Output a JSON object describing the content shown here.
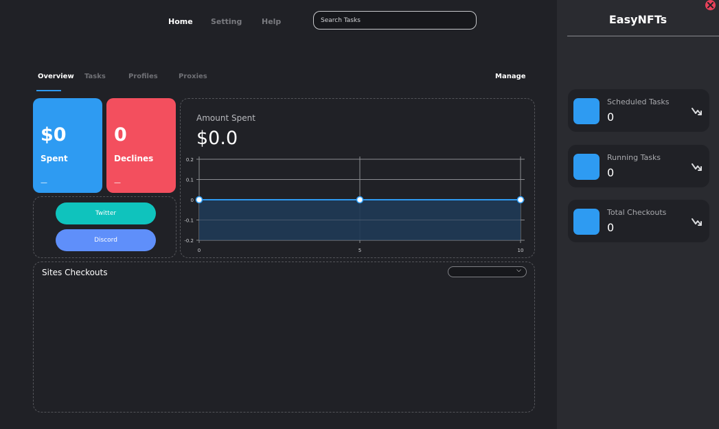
{
  "nav": {
    "home": "Home",
    "setting": "Setting",
    "help": "Help",
    "search_placeholder": "Search Tasks"
  },
  "subtabs": {
    "overview": "Overview",
    "tasks": "Tasks",
    "profiles": "Profiles",
    "proxies": "Proxies",
    "manage": "Manage"
  },
  "cards": {
    "spent_value": "$0",
    "spent_label": "Spent",
    "spent_foot": "—",
    "declines_value": "0",
    "declines_label": "Declines",
    "declines_foot": "—"
  },
  "social": {
    "twitter": "Twitter",
    "discord": "Discord"
  },
  "amount": {
    "label": "Amount Spent",
    "value": "$0.0"
  },
  "chart_data": {
    "type": "area",
    "x": [
      0,
      5,
      10
    ],
    "values": [
      0,
      0,
      0
    ],
    "xlim": [
      0,
      10
    ],
    "ylim": [
      -0.2,
      0.2
    ],
    "x_ticks": [
      "0",
      "5",
      "10"
    ],
    "y_ticks": [
      "0.2",
      "0.1",
      "0",
      "-0.1",
      "-0.2"
    ],
    "grid": true,
    "line_color": "#2e9bf2",
    "fill_color": "#1f3a56"
  },
  "sites": {
    "title": "Sites Checkouts"
  },
  "panel": {
    "brand": "EasyNFTs",
    "stats": [
      {
        "name": "Scheduled Tasks",
        "value": "0"
      },
      {
        "name": "Running Tasks",
        "value": "0"
      },
      {
        "name": "Total Checkouts",
        "value": "0"
      }
    ]
  },
  "colors": {
    "accent_blue": "#2e9bf2",
    "accent_red": "#f34f5e",
    "teal": "#0fc3bd",
    "discord": "#5f8ffa",
    "close": "#e8415a"
  }
}
